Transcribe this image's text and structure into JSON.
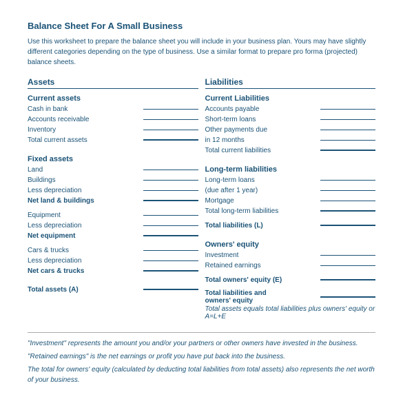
{
  "page": {
    "title": "Balance Sheet For A Small Business",
    "description": "Use this worksheet to prepare the balance sheet you will include in your business plan.  Yours may have slightly different categories depending on the type of business.  Use a similar format to prepare pro forma (projected) balance sheets.",
    "assets_header": "Assets",
    "liabilities_header": "Liabilities",
    "assets": {
      "current_assets_header": "Current assets",
      "current_rows": [
        "Cash in bank",
        "Accounts receivable",
        "Inventory",
        "Total current assets"
      ],
      "fixed_assets_header": "Fixed assets",
      "fixed_rows": [
        "Land",
        "Buildings",
        "Less depreciation",
        "Net land & buildings"
      ],
      "equipment_rows": [
        "Equipment",
        "Less depreciation",
        "Net equipment"
      ],
      "cars_rows": [
        "Cars & trucks",
        "Less depreciation",
        "Net cars & trucks"
      ],
      "total_assets": "Total assets (A)"
    },
    "liabilities": {
      "current_liabilities_header": "Current Liabilities",
      "current_rows": [
        "Accounts payable",
        "Short-term loans",
        "Other payments due",
        "in 12 months",
        "Total current liabilities"
      ],
      "longterm_header": "Long-term liabilities",
      "longterm_rows": [
        "Long-term loans",
        "(due after 1 year)",
        "Mortgage",
        "Total long-term liabilities"
      ],
      "total_liabilities": "Total liabilities (L)",
      "owners_equity_header": "Owners' equity",
      "owners_rows": [
        "Investment",
        "Retained earnings"
      ],
      "total_owners": "Total owners' equity (E)",
      "total_liabilities_equity": "Total liabilities and",
      "owners_equity_label": "owners' equity",
      "total_note_italic": "Total assets equals total liabilities plus owners' equity or A=L+E"
    },
    "footer": {
      "line1": "\"Investment\" represents the amount you and/or your partners or other owners have invested in the business.",
      "line2": "\"Retained earnings\" is the net earnings or profit you have put back into the business.",
      "line3": "The total for owners' equity (calculated by deducting total liabilities from total assets) also represents the net worth of your business."
    }
  }
}
